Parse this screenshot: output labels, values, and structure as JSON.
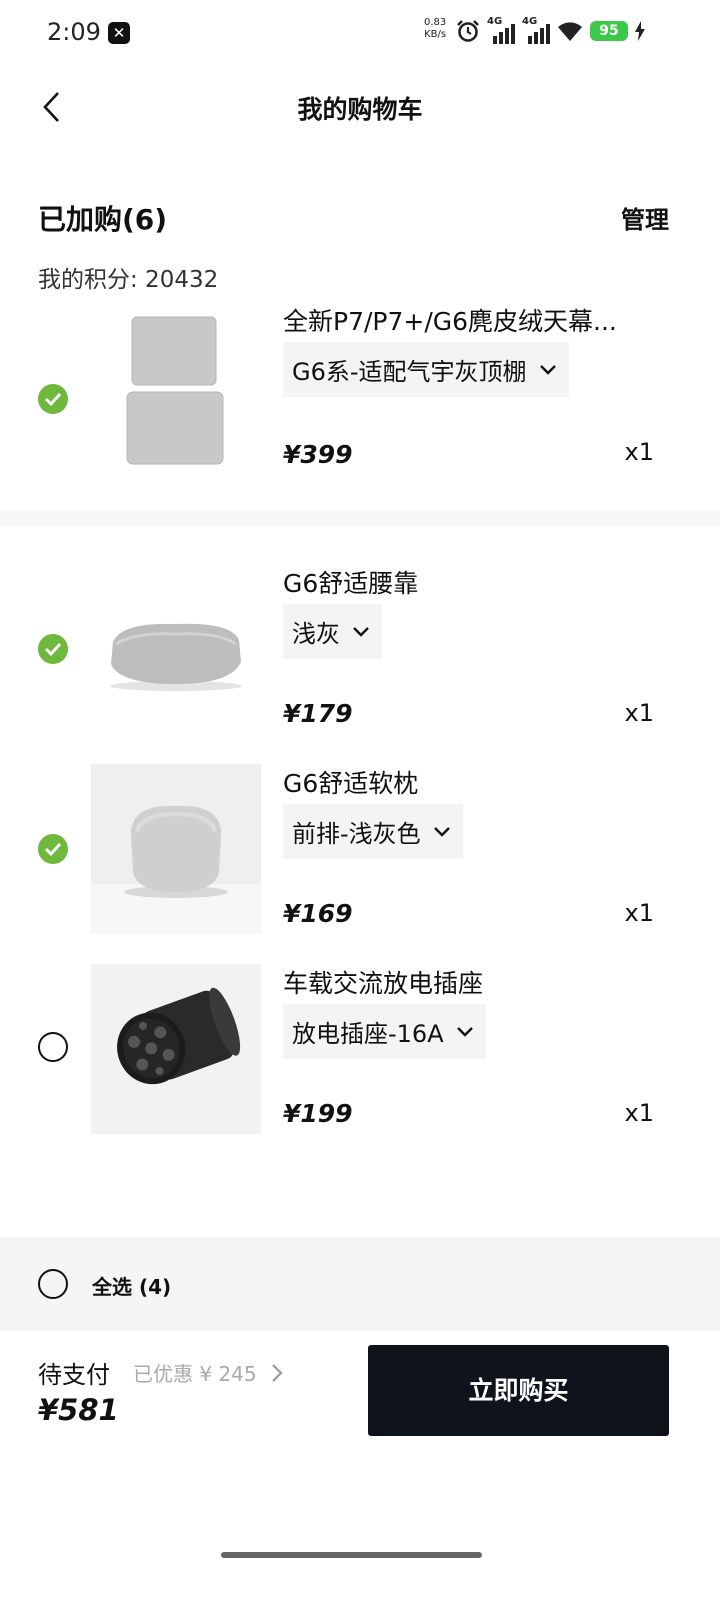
{
  "status": {
    "time": "2:09",
    "net_speed_value": "0.83",
    "net_speed_unit": "KB/s",
    "signal_1_label": "4G",
    "signal_2_label": "4G",
    "battery": "95"
  },
  "header": {
    "title": "我的购物车"
  },
  "cart": {
    "count_label": "已加购(6)",
    "manage_label": "管理",
    "points_label": "我的积分: 20432"
  },
  "items": [
    {
      "name": "全新P7/P7+/G6麂皮绒天幕...",
      "variant": "G6系-适配气宇灰顶棚",
      "price": "¥399",
      "qty": "x1",
      "checked": true
    },
    {
      "name": "G6舒适腰靠",
      "variant": "浅灰",
      "price": "¥179",
      "qty": "x1",
      "checked": true
    },
    {
      "name": "G6舒适软枕",
      "variant": "前排-浅灰色",
      "price": "¥169",
      "qty": "x1",
      "checked": true
    },
    {
      "name": "车载交流放电插座",
      "variant": "放电插座-16A",
      "price": "¥199",
      "qty": "x1",
      "checked": false
    }
  ],
  "select_all": {
    "label": "全选 (4)"
  },
  "footer": {
    "pay_label": "待支付",
    "discount_label": "已优惠 ¥ 245",
    "total": "¥581",
    "buy_label": "立即购买"
  },
  "colors": {
    "check_green": "#6fb83e",
    "buy_button": "#0f141c",
    "battery_green": "#3cc94a"
  }
}
